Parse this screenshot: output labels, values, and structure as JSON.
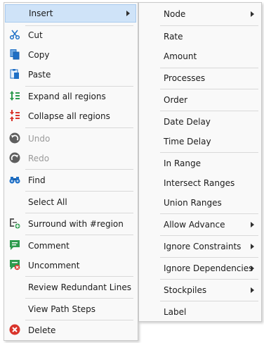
{
  "main_menu": {
    "insert": "Insert",
    "cut": "Cut",
    "copy": "Copy",
    "paste": "Paste",
    "expand_all": "Expand all regions",
    "collapse_all": "Collapse all regions",
    "undo": "Undo",
    "redo": "Redo",
    "find": "Find",
    "select_all": "Select All",
    "surround": "Surround with #region",
    "comment": "Comment",
    "uncomment": "Uncomment",
    "review": "Review Redundant Lines",
    "view_path": "View Path Steps",
    "delete": "Delete"
  },
  "sub_menu": {
    "node": "Node",
    "rate": "Rate",
    "amount": "Amount",
    "processes": "Processes",
    "order": "Order",
    "date_delay": "Date Delay",
    "time_delay": "Time Delay",
    "in_range": "In Range",
    "intersect_ranges": "Intersect Ranges",
    "union_ranges": "Union Ranges",
    "allow_advance": "Allow Advance",
    "ignore_constraints": "Ignore Constraints",
    "ignore_dependencies": "Ignore Dependencies",
    "stockpiles": "Stockpiles",
    "label": "Label"
  },
  "colors": {
    "highlight": "#cfe3f8",
    "accent_blue": "#1e6fc6",
    "green": "#2e9b4e",
    "red": "#d9342b"
  }
}
